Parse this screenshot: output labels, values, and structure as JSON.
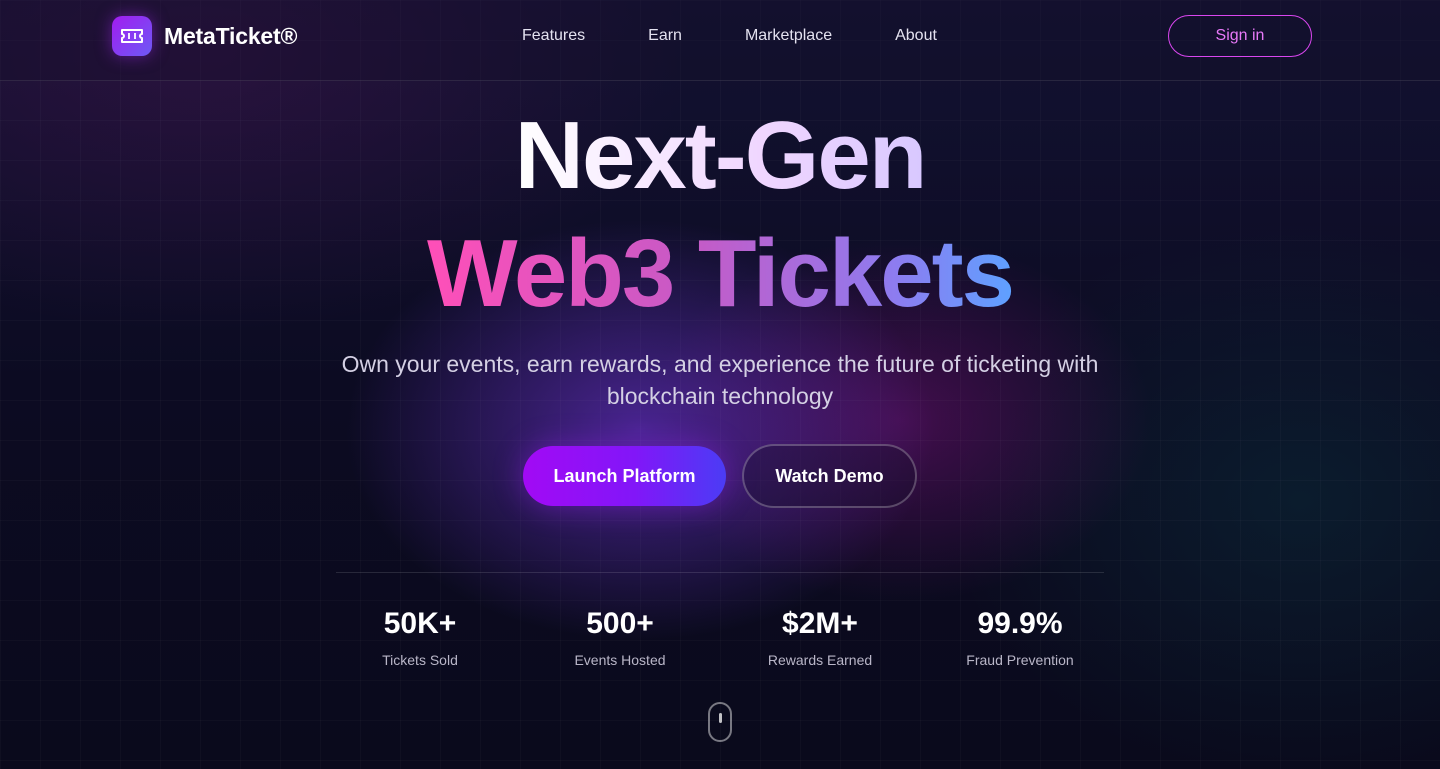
{
  "brand": {
    "name": "MetaTicket®",
    "logo_icon": "ticket-icon",
    "accent_colors": [
      "#a21cf0",
      "#6d5af5"
    ]
  },
  "nav": {
    "items": [
      {
        "label": "Features"
      },
      {
        "label": "Earn"
      },
      {
        "label": "Marketplace"
      },
      {
        "label": "About"
      }
    ],
    "sign_in_label": "Sign in"
  },
  "hero": {
    "line1": "Next-Gen",
    "line2": "Web3 Tickets",
    "subtitle": "Own your events, earn rewards, and experience the future of ticketing with blockchain technology",
    "primary_button": "Launch Platform",
    "secondary_button": "Watch Demo"
  },
  "stats": [
    {
      "value": "50K+",
      "label": "Tickets Sold"
    },
    {
      "value": "500+",
      "label": "Events Hosted"
    },
    {
      "value": "$2M+",
      "label": "Rewards Earned"
    },
    {
      "value": "99.9%",
      "label": "Fraud Prevention"
    }
  ],
  "scroll_indicator_icon": "mouse-scroll-icon"
}
